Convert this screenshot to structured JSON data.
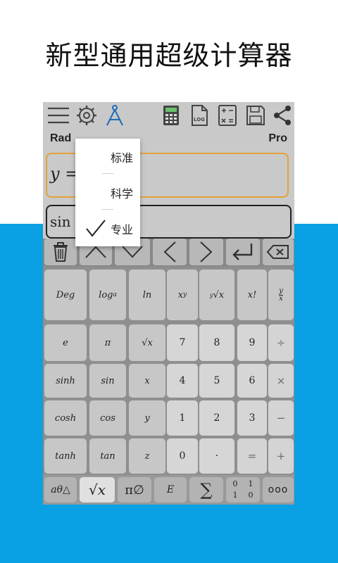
{
  "promo": {
    "title": "新型通用超级计算器"
  },
  "toolbar": {
    "icons": [
      "menu-icon",
      "gear-icon",
      "compass-icon",
      "calculator-icon",
      "log-file-icon",
      "formula-sheet-icon",
      "save-icon",
      "share-icon"
    ],
    "log_label": "LOG"
  },
  "mode": {
    "angle": "Rad",
    "tier": "Pro"
  },
  "display": {
    "expression": "y =",
    "input": "sin ("
  },
  "dropdown": {
    "items": [
      {
        "label": "标准"
      },
      {
        "label": "科学"
      },
      {
        "label": "专业",
        "checked": true
      }
    ]
  },
  "keypad": {
    "rows": [
      [
        "Deg",
        "loga",
        "ln",
        "xʸ",
        "ʸ√x",
        "x!",
        "y/x"
      ],
      [
        "e",
        "π",
        "√x",
        "7",
        "8",
        "9",
        "÷"
      ],
      [
        "sinh",
        "sin",
        "x",
        "4",
        "5",
        "6",
        "×"
      ],
      [
        "cosh",
        "cos",
        "y",
        "1",
        "2",
        "3",
        "−"
      ],
      [
        "tanh",
        "tan",
        "z",
        "0",
        "·",
        "=",
        "+"
      ]
    ]
  },
  "bottom": {
    "greek": "aθ△",
    "sqrt": "√x",
    "sets": "π∅",
    "exp": "E",
    "sum": "∑",
    "binary": [
      "0",
      "1",
      "1",
      "0"
    ],
    "more": "ooo"
  }
}
